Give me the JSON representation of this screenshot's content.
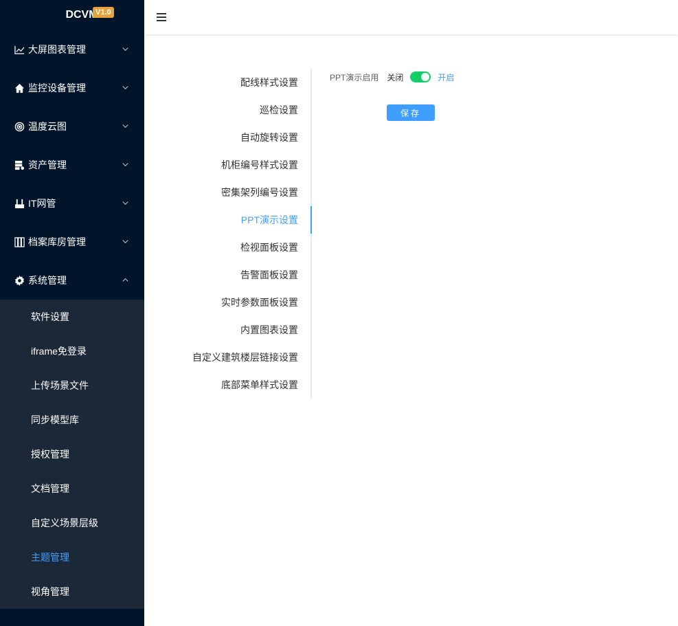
{
  "brand": {
    "name": "DCVM",
    "version": "V1.0"
  },
  "sidebar": {
    "menus": [
      {
        "label": "大屏图表管理",
        "icon": "chart-line-icon",
        "expanded": false
      },
      {
        "label": "监控设备管理",
        "icon": "home-icon",
        "expanded": false
      },
      {
        "label": "温度云图",
        "icon": "target-icon",
        "expanded": false
      },
      {
        "label": "资产管理",
        "icon": "server-gear-icon",
        "expanded": false
      },
      {
        "label": "IT网管",
        "icon": "router-icon",
        "expanded": false
      },
      {
        "label": "档案库房管理",
        "icon": "archive-shelf-icon",
        "expanded": false
      },
      {
        "label": "系统管理",
        "icon": "gear-icon",
        "expanded": true
      }
    ],
    "submenu": [
      {
        "label": "软件设置"
      },
      {
        "label": "iframe免登录"
      },
      {
        "label": "上传场景文件"
      },
      {
        "label": "同步模型库"
      },
      {
        "label": "授权管理"
      },
      {
        "label": "文档管理"
      },
      {
        "label": "自定义场景层级"
      },
      {
        "label": "主题管理",
        "active": true
      },
      {
        "label": "视角管理"
      }
    ]
  },
  "header": {
    "menu_toggle_icon": "hamburger-icon"
  },
  "settings_nav": {
    "items": [
      {
        "label": "配线样式设置"
      },
      {
        "label": "巡检设置"
      },
      {
        "label": "自动旋转设置"
      },
      {
        "label": "机柜编号样式设置"
      },
      {
        "label": "密集架列编号设置"
      },
      {
        "label": "PPT演示设置",
        "active": true
      },
      {
        "label": "检视面板设置"
      },
      {
        "label": "告警面板设置"
      },
      {
        "label": "实时参数面板设置"
      },
      {
        "label": "内置图表设置"
      },
      {
        "label": "自定义建筑楼层链接设置"
      },
      {
        "label": "底部菜单样式设置"
      }
    ]
  },
  "form": {
    "ppt_label": "PPT演示启用",
    "off_text": "关闭",
    "on_text": "开启",
    "enabled": true,
    "save_label": "保存"
  },
  "colors": {
    "sidebar_bg": "#001529",
    "submenu_bg": "#1b2838",
    "accent": "#409eff",
    "switch_on": "#13ce66",
    "badge": "#e6a23c"
  }
}
